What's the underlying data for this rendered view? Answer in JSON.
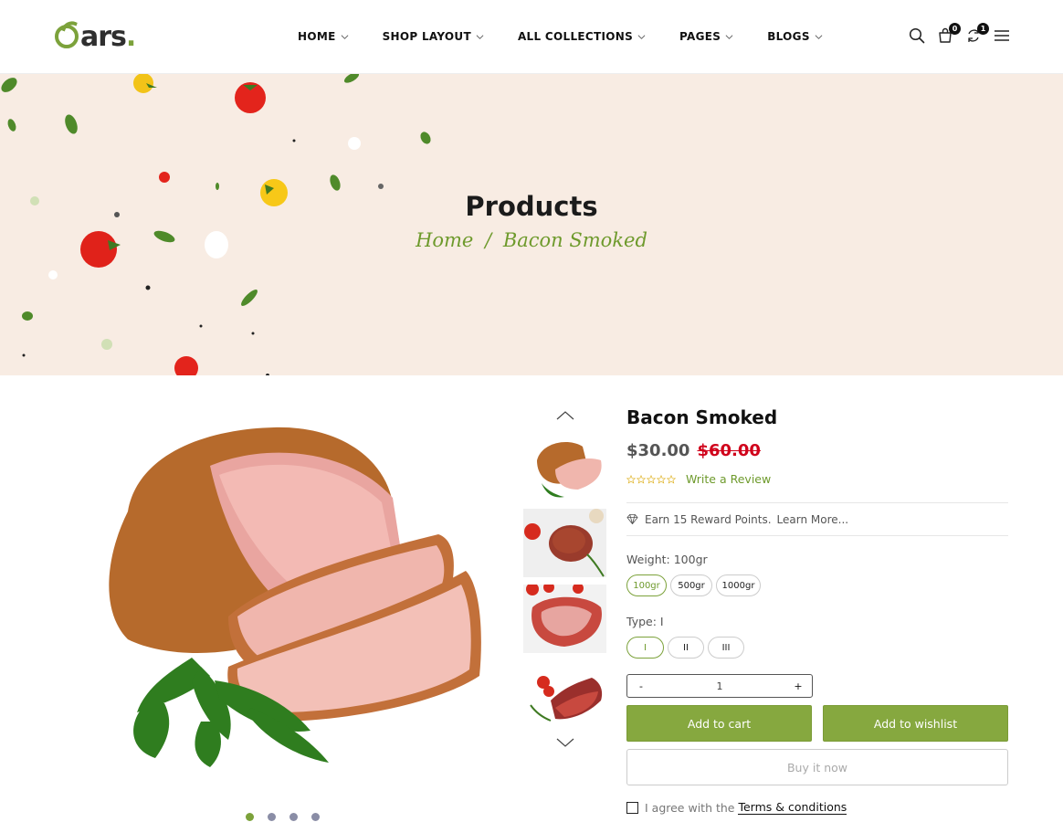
{
  "header": {
    "logo": {
      "letter": "ars",
      "dot": ".",
      "brand": "Oars."
    },
    "nav": [
      {
        "label": "HOME"
      },
      {
        "label": "SHOP LAYOUT"
      },
      {
        "label": "ALL COLLECTIONS"
      },
      {
        "label": "PAGES"
      },
      {
        "label": "BLOGS"
      }
    ],
    "icons": {
      "search": "search-icon",
      "cart": "cart-icon",
      "cart_count": "0",
      "compare": "compare-icon",
      "compare_count": "1",
      "menu": "menu-icon"
    }
  },
  "hero": {
    "title": "Products",
    "breadcrumb": {
      "home": "Home",
      "separator": "/",
      "current": "Bacon Smoked"
    }
  },
  "gallery": {
    "main_image": "smoked-ham-image",
    "thumbnails": [
      "smoked-ham-thumb",
      "steak-spices-thumb",
      "raw-meat-thumb",
      "meat-cuts-thumb"
    ],
    "dots_count": 4,
    "active_dot": 1
  },
  "product": {
    "title": "Bacon Smoked",
    "price": "$30.00",
    "old_price": "$60.00",
    "rating": 0,
    "rating_max": 5,
    "write_review": "Write a Review",
    "reward_text": "Earn 15 Reward Points.",
    "reward_link": "Learn More...",
    "weight_label": "Weight: 100gr",
    "weights": [
      "100gr",
      "500gr",
      "1000gr"
    ],
    "type_label": "Type: I",
    "types": [
      "I",
      "II",
      "III"
    ],
    "qty": {
      "minus": "-",
      "value": "1",
      "plus": "+"
    },
    "add_to_cart": "Add to cart",
    "add_to_wishlist": "Add to wishlist",
    "buy_now": "Buy it now",
    "agree_text": "I agree with the",
    "terms_link": "Terms & conditions"
  },
  "colors": {
    "accent": "#7ca23b",
    "button": "#86a83f",
    "sale": "#d0021b",
    "hero_bg": "#f8ece3"
  }
}
